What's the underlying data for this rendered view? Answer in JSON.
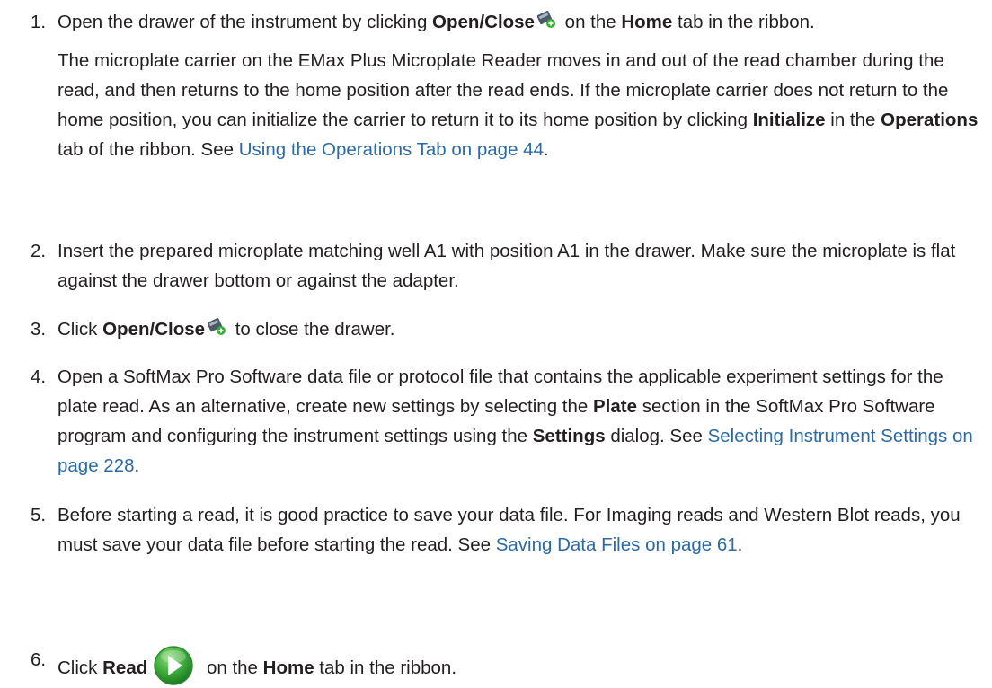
{
  "steps": [
    {
      "num": "1.",
      "parts": {
        "t1": "Open the drawer of the instrument by clicking ",
        "b1": "Open/Close",
        "t2": " on the ",
        "b2": "Home",
        "t3": " tab in the ribbon."
      },
      "note": {
        "t1": "The microplate carrier on the EMax Plus Microplate Reader moves in and out of the read chamber during the read, and then returns to the home position after the read ends. If the microplate carrier does not return to the home position, you can initialize the carrier to return it to its home position by clicking ",
        "b1": "Initialize",
        "t2": " in the ",
        "b2": "Operations",
        "t3": " tab of the ribbon. See ",
        "link": "Using the Operations Tab on page 44",
        "t4": "."
      }
    },
    {
      "num": "2.",
      "text": "Insert the prepared microplate matching well A1 with position A1 in the drawer. Make sure the microplate is flat against the drawer bottom or against the adapter."
    },
    {
      "num": "3.",
      "parts": {
        "t1": "Click ",
        "b1": "Open/Close",
        "t2": " to close the drawer."
      }
    },
    {
      "num": "4.",
      "parts": {
        "t1": "Open a SoftMax Pro Software data file or protocol file that contains the applicable experiment settings for the plate read. As an alternative, create new settings by selecting the ",
        "b1": "Plate",
        "t2": " section in the SoftMax Pro Software program and configuring the instrument settings using the ",
        "b2": "Settings",
        "t3": " dialog. See ",
        "link": "Selecting Instrument Settings on page 228",
        "t4": "."
      }
    },
    {
      "num": "5.",
      "parts": {
        "t1": "Before starting a read, it is good practice to save your data file. For Imaging reads and Western Blot reads, you must save your data file before starting the read. See ",
        "link": "Saving Data Files on page 61",
        "t2": "."
      }
    },
    {
      "num": "6.",
      "parts": {
        "t1": "Click ",
        "b1": "Read",
        "t2": " on the ",
        "b2": "Home",
        "t3": " tab in the ribbon."
      }
    }
  ],
  "icons": {
    "open_close": "open-close-drawer-icon",
    "read": "read-play-icon"
  },
  "colors": {
    "text": "#231f20",
    "link": "#2b6aa3",
    "read_icon_green": "#3aa83a"
  }
}
